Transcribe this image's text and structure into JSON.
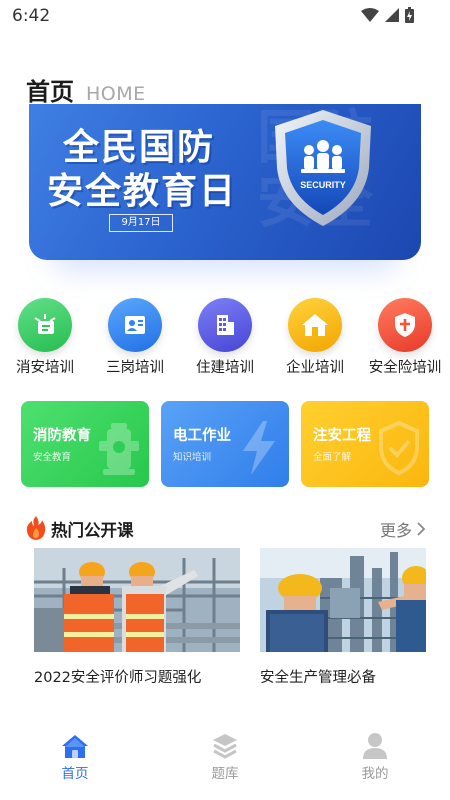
{
  "status_bar": {
    "time": "6:42"
  },
  "header": {
    "title": "首页",
    "subtitle": "HOME"
  },
  "banner": {
    "line1": "全民国防",
    "line2": "安全教育日",
    "date": "9月17日",
    "shield_text": "SECURITY",
    "ghost_text": "国防安全"
  },
  "categories": [
    {
      "label": "消安培训",
      "icon": "fire-training-icon",
      "color": "#34c759"
    },
    {
      "label": "三岗培训",
      "icon": "id-card-icon",
      "color": "#2f86f0"
    },
    {
      "label": "住建培训",
      "icon": "building-icon",
      "color": "#5b5ce8"
    },
    {
      "label": "企业培训",
      "icon": "house-icon",
      "color": "#f7b500"
    },
    {
      "label": "安全险培训",
      "icon": "shield-icon",
      "color": "#f25537"
    }
  ],
  "cards": [
    {
      "title": "消防教育",
      "subtitle": "安全教育",
      "icon": "hydrant-icon",
      "color": "#37d05b"
    },
    {
      "title": "电工作业",
      "subtitle": "知识培训",
      "icon": "lightning-icon",
      "color": "#3d8ef2"
    },
    {
      "title": "注安工程",
      "subtitle": "全面了解",
      "icon": "shield-check-icon",
      "color": "#fcb91a"
    }
  ],
  "section": {
    "title": "热门公开课",
    "more": "更多"
  },
  "courses": [
    {
      "title": "2022安全评价师习题强化"
    },
    {
      "title": "安全生产管理必备"
    }
  ],
  "tabs": [
    {
      "label": "首页",
      "icon": "home-icon",
      "active": true
    },
    {
      "label": "题库",
      "icon": "layers-icon",
      "active": false
    },
    {
      "label": "我的",
      "icon": "user-icon",
      "active": false
    }
  ],
  "colors": {
    "accent": "#2d6ff0",
    "inactive": "#9a9a9a"
  }
}
